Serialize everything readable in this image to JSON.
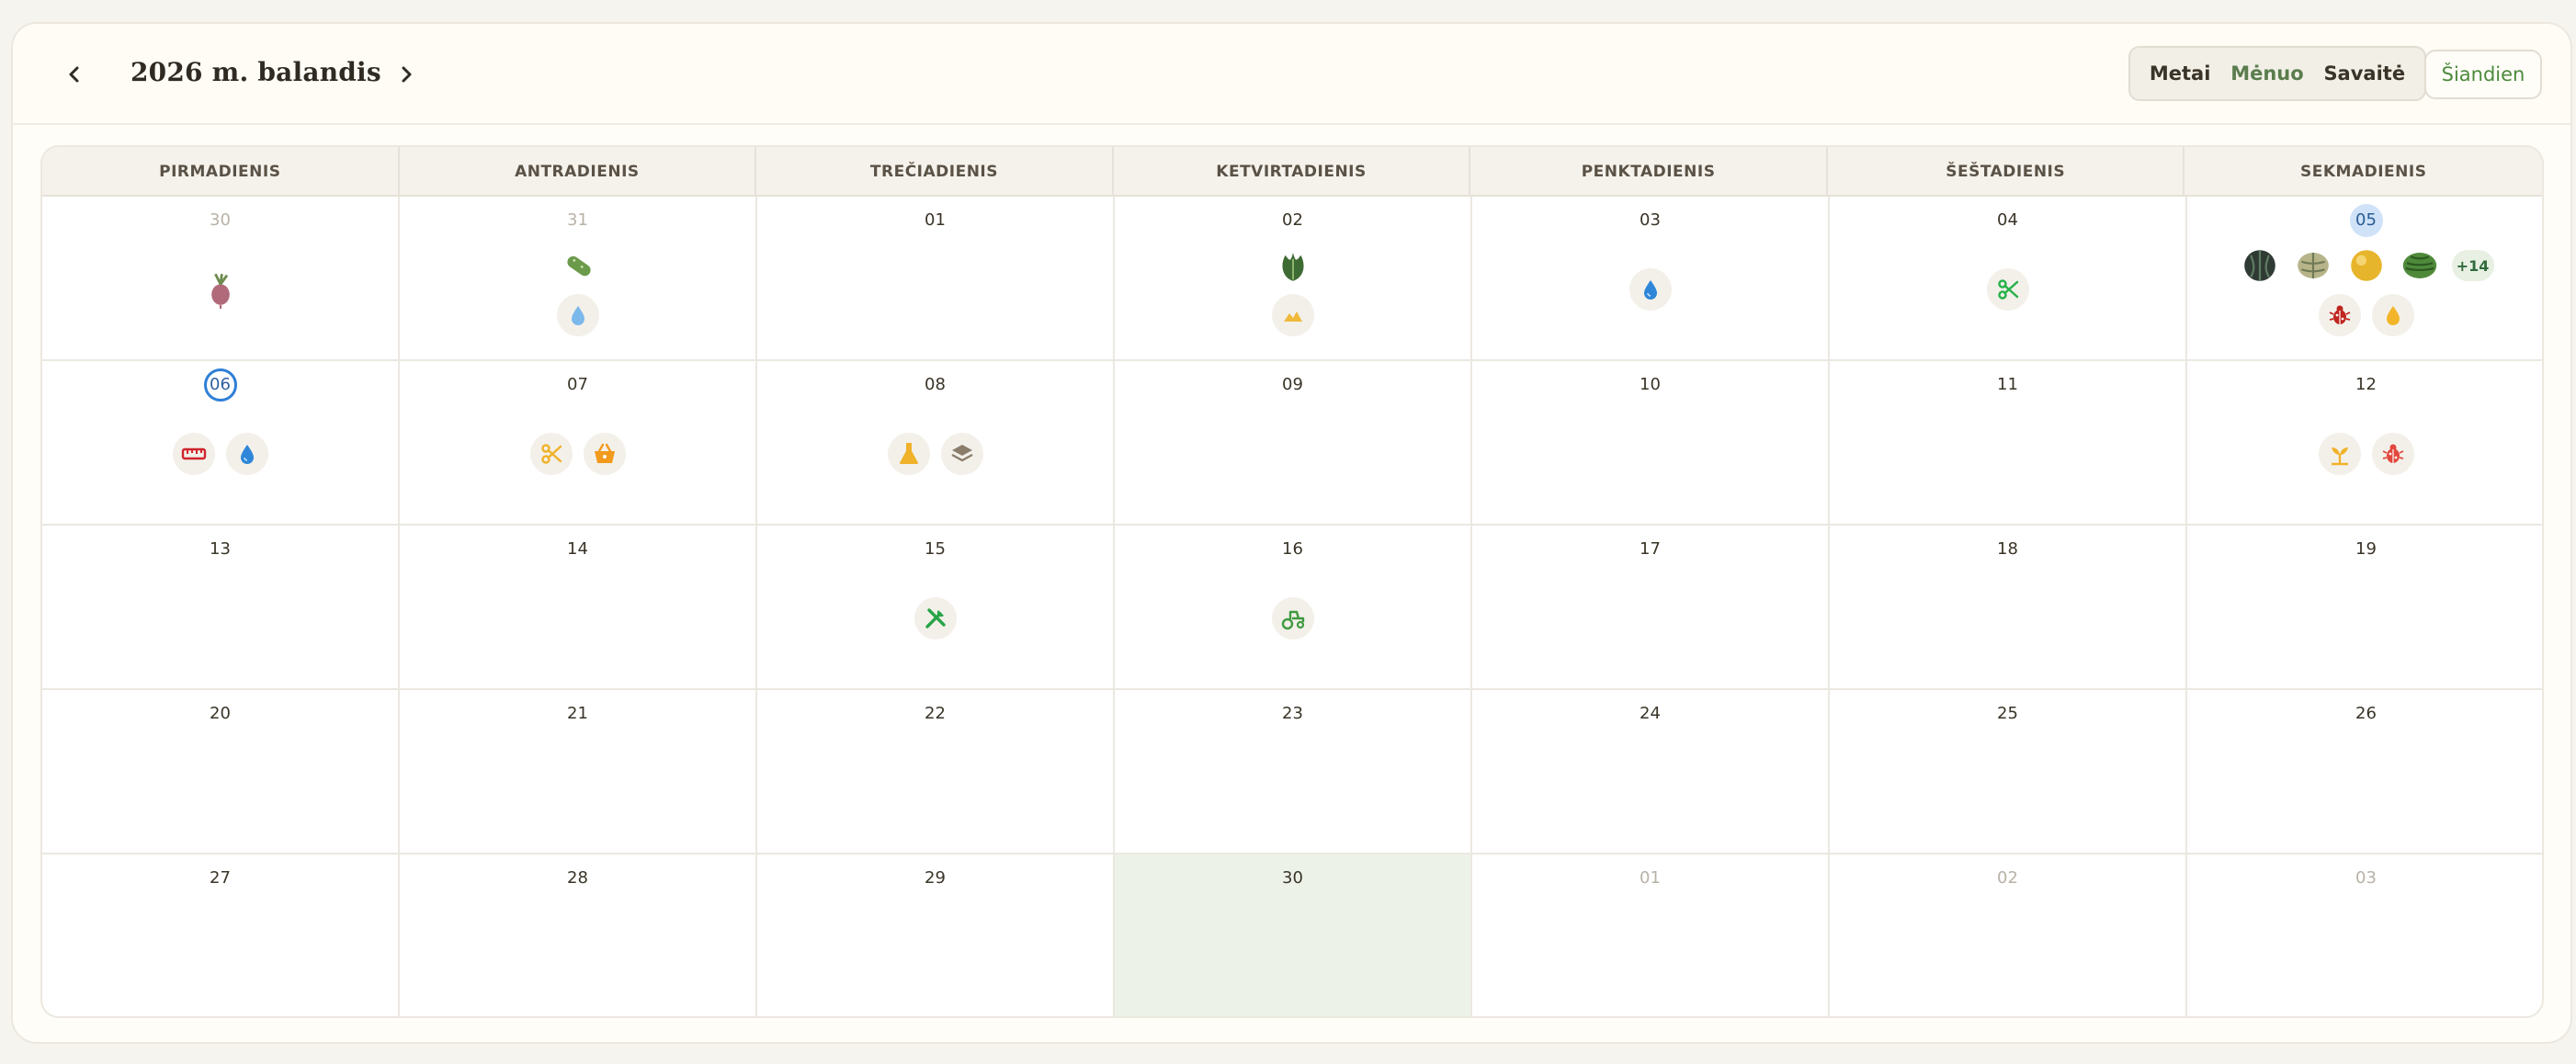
{
  "header": {
    "title": "2026 m. balandis",
    "views": [
      "Metai",
      "Mėnuo",
      "Savaitė"
    ],
    "active_view": "Mėnuo",
    "today_label": "Šiandien"
  },
  "weekdays": [
    "PIRMADIENIS",
    "ANTRADIENIS",
    "TREČIADIENIS",
    "KETVIRTADIENIS",
    "PENKTADIENIS",
    "ŠEŠTADIENIS",
    "SEKMADIENIS"
  ],
  "weeks": [
    [
      {
        "label": "30",
        "other": true,
        "icons": [
          [
            "beet-icon"
          ]
        ]
      },
      {
        "label": "31",
        "other": true,
        "icons": [
          [
            "cucumber-icon"
          ],
          [
            "water-drop-light-icon"
          ]
        ]
      },
      {
        "label": "01",
        "icons": []
      },
      {
        "label": "02",
        "icons": [
          [
            "lettuce-icon"
          ],
          [
            "soil-icon"
          ]
        ]
      },
      {
        "label": "03",
        "icons": [
          [
            "water-drop-icon"
          ]
        ]
      },
      {
        "label": "04",
        "icons": [
          [
            "scissors-green-icon"
          ]
        ]
      },
      {
        "label": "05",
        "marker": "filled",
        "icons": [
          [
            "watermelon-dark-icon",
            "melon-striped-icon",
            "melon-yellow-icon",
            "watermelon-icon",
            "more"
          ],
          [
            "bug-icon",
            "oil-drop-icon"
          ]
        ],
        "more_label": "+14"
      }
    ],
    [
      {
        "label": "06",
        "marker": "ring",
        "icons": [
          [
            "ruler-icon",
            "water-drop-icon"
          ]
        ]
      },
      {
        "label": "07",
        "icons": [
          [
            "scissors-yellow-icon",
            "basket-icon"
          ]
        ]
      },
      {
        "label": "08",
        "icons": [
          [
            "flask-icon",
            "layers-icon"
          ]
        ]
      },
      {
        "label": "09",
        "icons": []
      },
      {
        "label": "10",
        "icons": []
      },
      {
        "label": "11",
        "icons": []
      },
      {
        "label": "12",
        "icons": [
          [
            "sprout-icon",
            "bug-red-icon"
          ]
        ]
      }
    ],
    [
      {
        "label": "13",
        "icons": []
      },
      {
        "label": "14",
        "icons": []
      },
      {
        "label": "15",
        "icons": [
          [
            "tools-icon"
          ]
        ]
      },
      {
        "label": "16",
        "icons": [
          [
            "tractor-icon"
          ]
        ]
      },
      {
        "label": "17",
        "icons": []
      },
      {
        "label": "18",
        "icons": []
      },
      {
        "label": "19",
        "icons": []
      }
    ],
    [
      {
        "label": "20",
        "icons": []
      },
      {
        "label": "21",
        "icons": []
      },
      {
        "label": "22",
        "icons": []
      },
      {
        "label": "23",
        "icons": []
      },
      {
        "label": "24",
        "icons": []
      },
      {
        "label": "25",
        "icons": []
      },
      {
        "label": "26",
        "icons": []
      }
    ],
    [
      {
        "label": "27",
        "icons": []
      },
      {
        "label": "28",
        "icons": []
      },
      {
        "label": "29",
        "icons": []
      },
      {
        "label": "30",
        "highlight": true,
        "icons": []
      },
      {
        "label": "01",
        "other": true,
        "icons": []
      },
      {
        "label": "02",
        "other": true,
        "icons": []
      },
      {
        "label": "03",
        "other": true,
        "icons": []
      }
    ]
  ],
  "colors": {
    "accent_green": "#4c8a3c",
    "today_highlight": "#edf2e8",
    "ring_blue": "#2f7fd6"
  }
}
